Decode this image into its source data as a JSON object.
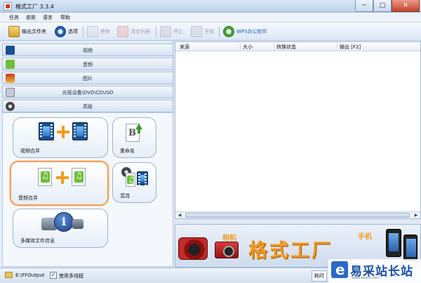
{
  "window": {
    "title": "格式工厂 3.3.4",
    "buttons": [
      "─",
      "□",
      "✕"
    ]
  },
  "menu": {
    "items": [
      "任务",
      "皮肤",
      "语言",
      "帮助"
    ]
  },
  "toolbar": {
    "output_folder": "输出文件夹",
    "options": "选项",
    "remove": "移除",
    "clear_list": "清空列表",
    "stop": "停止",
    "start": "开始",
    "wps": "WPS办公软件"
  },
  "sidebar": {
    "categories": [
      "视频",
      "音频",
      "图片",
      "光驱设备\\DVD\\CD\\ISO",
      "高级"
    ],
    "tiles": {
      "video_merge": "视频合并",
      "rename": "重命名",
      "audio_merge": "音频合并",
      "mix": "混流",
      "media_info": "多媒体文件信息"
    }
  },
  "task_list": {
    "columns": [
      "来源",
      "大小",
      "转换状态",
      "输出 [F2]"
    ]
  },
  "status": {
    "output_path": "E:\\FFOutput",
    "multithread_label": "使用多线程",
    "multithread_checked": true,
    "elapsed_label": "耗时"
  },
  "banner": {
    "title": "格式工厂",
    "tag_camera": "相机",
    "tag_phone": "手机"
  },
  "watermark": {
    "text": "易采站长站",
    "sub": "www.easck.com"
  }
}
